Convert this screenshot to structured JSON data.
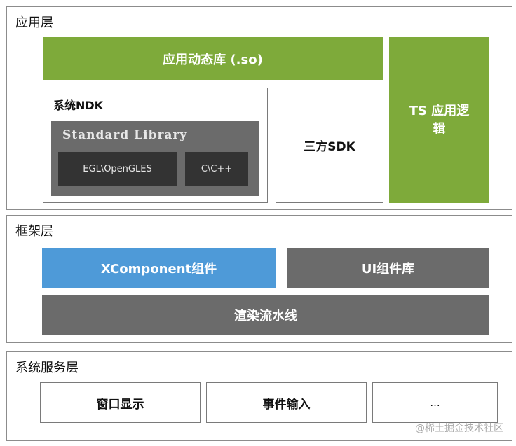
{
  "app_layer": {
    "title": "应用层",
    "dynamic_lib": "应用动态库 (.so)",
    "ndk_title": "系统NDK",
    "std_lib": "Standard Library",
    "egl": "EGL\\OpenGLES",
    "cpp": "C\\C++",
    "third_sdk": "三方SDK",
    "ts_logic": "TS 应用逻辑"
  },
  "framework_layer": {
    "title": "框架层",
    "xcomponent": "XComponent组件",
    "ui_lib": "UI组件库",
    "render_pipeline": "渲染流水线"
  },
  "system_layer": {
    "title": "系统服务层",
    "window_display": "窗口显示",
    "event_input": "事件输入",
    "more": "..."
  },
  "watermark": "@稀土掘金技术社区",
  "colors": {
    "green": "#7eaa3a",
    "blue": "#4e9ad8",
    "gray": "#6b6b6b"
  }
}
